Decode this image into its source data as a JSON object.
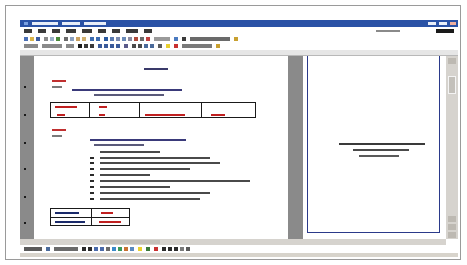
{
  "window": {
    "title": "",
    "accent_color": "#2a52a6",
    "document_border_color": "#2b3a8a",
    "highlight_color": "#cc1a1a"
  },
  "toolbar": {
    "menu_items": [],
    "icons": [
      "new-icon",
      "open-icon",
      "save-icon",
      "print-icon",
      "preview-icon",
      "spelling-icon",
      "cut-icon",
      "copy-icon",
      "paste-icon",
      "format-painter-icon",
      "undo-icon",
      "redo-icon",
      "hyperlink-icon",
      "table-icon",
      "columns-icon",
      "drawing-icon",
      "zoom-select",
      "help-icon"
    ],
    "formatting_icons": [
      "style-select",
      "font-select",
      "font-size-select",
      "bold-icon",
      "italic-icon",
      "underline-icon",
      "align-left-icon",
      "align-center-icon",
      "align-right-icon",
      "justify-icon",
      "numbering-icon",
      "bullets-icon",
      "decrease-indent-icon",
      "increase-indent-icon",
      "border-icon",
      "highlight-icon",
      "font-color-icon"
    ]
  },
  "document": {
    "page1": {
      "heading": "",
      "section1_title": "",
      "section2_title": "",
      "table1": {
        "headers": [
          "",
          "",
          "",
          ""
        ],
        "row": [
          "",
          "",
          "",
          ""
        ]
      },
      "table2": {
        "headers": [
          "",
          ""
        ],
        "row": [
          "",
          ""
        ]
      }
    },
    "page2": {
      "title_lines": [
        "",
        "",
        ""
      ]
    }
  },
  "status": {
    "text": ""
  }
}
